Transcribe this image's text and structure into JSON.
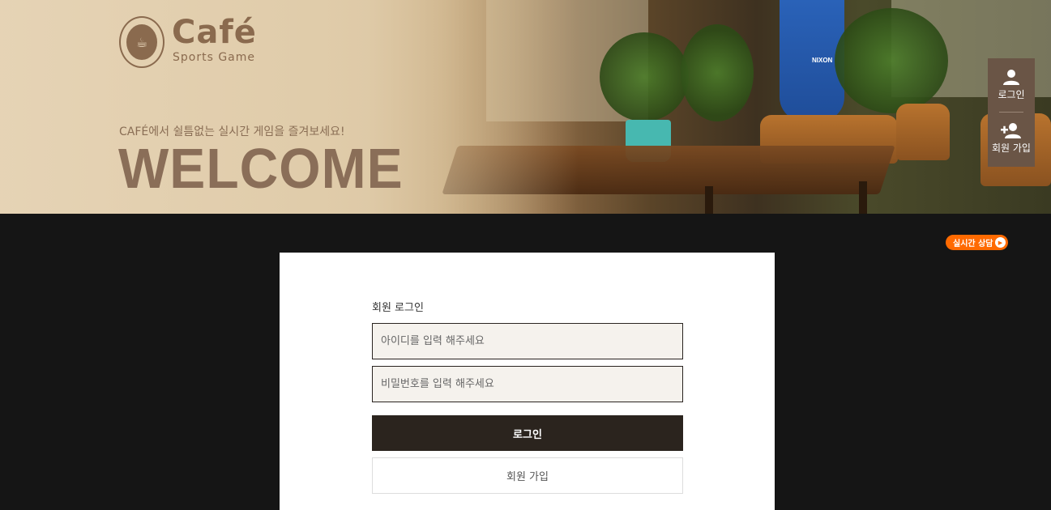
{
  "brand": {
    "name": "Café",
    "subtitle": "Sports Game",
    "color": "#8a6a4e"
  },
  "hero": {
    "tagline": "CAFÉ에서 쉴틈없는 실시간 게임을 즐겨보세요!",
    "headline": "WELCOME"
  },
  "side_menu": {
    "login_label": "로그인",
    "join_label": "회원 가입",
    "background": "#6a5546"
  },
  "live_chat": {
    "label": "실시간 상담",
    "color": "#ff6a00"
  },
  "login_form": {
    "title": "회원 로그인",
    "id_placeholder": "아이디를 입력 해주세요",
    "id_value": "",
    "password_placeholder": "비밀번호를 입력 해주세요",
    "password_value": "",
    "login_button": "로그인",
    "join_button": "회원 가입",
    "button_color": "#2b241e"
  }
}
